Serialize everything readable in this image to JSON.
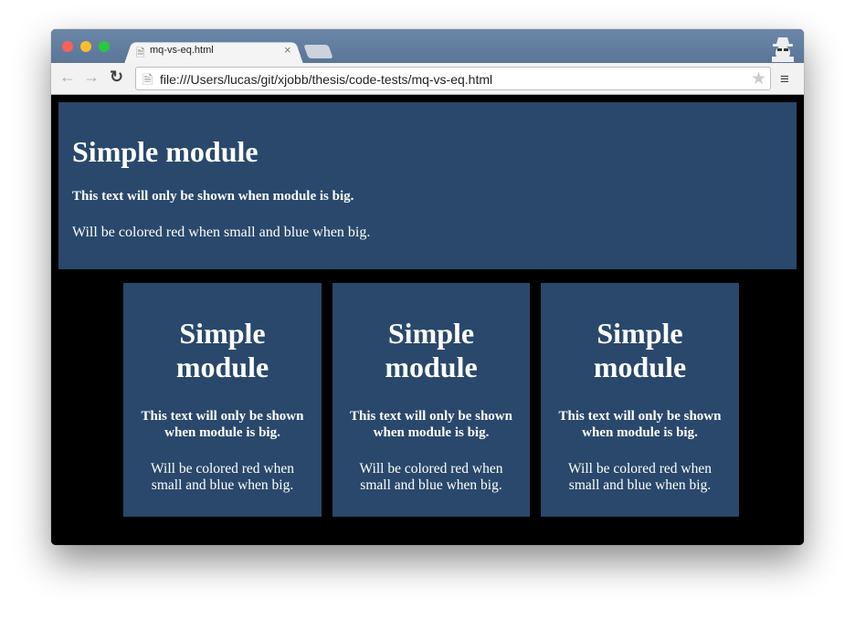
{
  "browser": {
    "tab_title": "mq-vs-eq.html",
    "url": "file:///Users/lucas/git/xjobb/thesis/code-tests/mq-vs-eq.html",
    "colors": {
      "close": "#fc5f57",
      "minimize": "#fdbc2e",
      "maximize": "#28c840"
    }
  },
  "page": {
    "big_module": {
      "title": "Simple module",
      "big_text": "This text will only be shown when module is big.",
      "color_text": "Will be colored red when small and blue when big."
    },
    "small_modules": [
      {
        "title": "Simple module",
        "big_text": "This text will only be shown when module is big.",
        "color_text": "Will be colored red when small and blue when big."
      },
      {
        "title": "Simple module",
        "big_text": "This text will only be shown when module is big.",
        "color_text": "Will be colored red when small and blue when big."
      },
      {
        "title": "Simple module",
        "big_text": "This text will only be shown when module is big.",
        "color_text": "Will be colored red when small and blue when big."
      }
    ],
    "module_color": "#29486b"
  }
}
